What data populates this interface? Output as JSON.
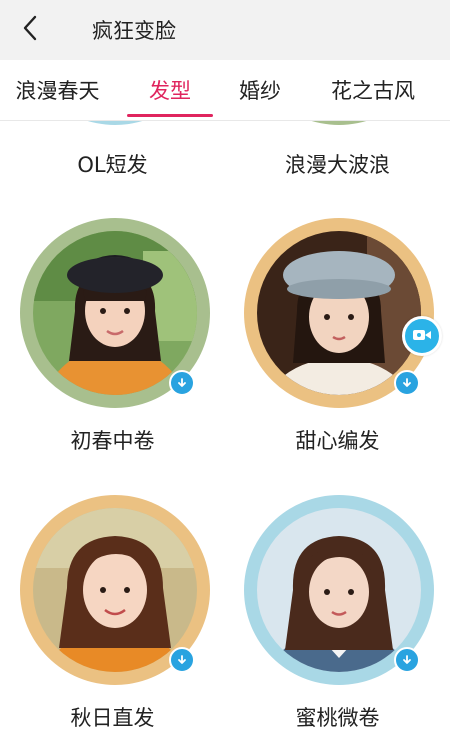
{
  "header": {
    "title": "疯狂变脸",
    "back_icon": "chevron-left-icon"
  },
  "tabs": [
    {
      "label": "浪漫春天",
      "active": false
    },
    {
      "label": "发型",
      "active": true
    },
    {
      "label": "婚纱",
      "active": false
    },
    {
      "label": "花之古风",
      "active": false
    }
  ],
  "colors": {
    "accent": "#e0245e",
    "badge": "#29a3e0",
    "ring_green": "#a8bf8e",
    "ring_orange": "#ebc182",
    "ring_blue": "#a9d8e6"
  },
  "styles": [
    {
      "label": "OL短发",
      "ring_color": "#a9d8e6"
    },
    {
      "label": "浪漫大波浪",
      "ring_color": "#a8bf8e"
    },
    {
      "label": "初春中卷",
      "ring_color": "#a8bf8e",
      "icon": "download-icon"
    },
    {
      "label": "甜心编发",
      "ring_color": "#ebc182",
      "icon": "download-icon",
      "extra_icon": "video-camera-icon"
    },
    {
      "label": "秋日直发",
      "ring_color": "#ebc182",
      "icon": "download-icon"
    },
    {
      "label": "蜜桃微卷",
      "ring_color": "#a9d8e6",
      "icon": "download-icon"
    }
  ]
}
